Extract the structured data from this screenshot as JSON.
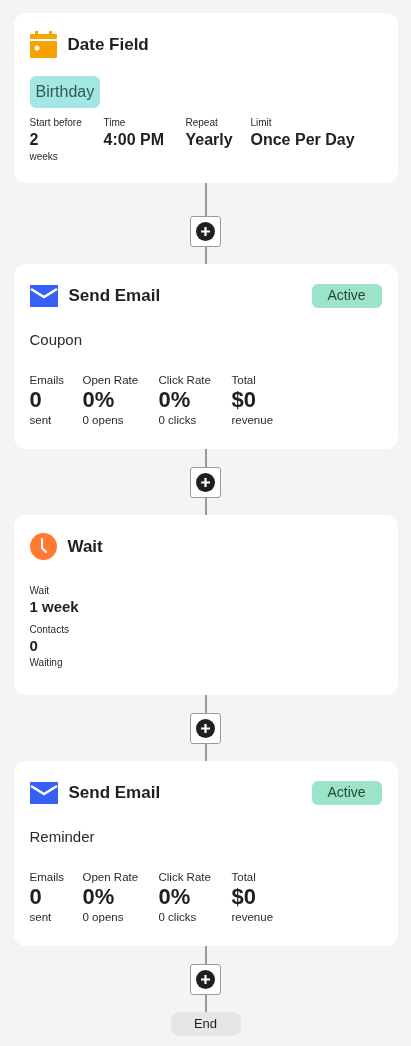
{
  "steps": [
    {
      "kind": "trigger",
      "title": "Date Field",
      "tag": "Birthday",
      "stats": [
        {
          "label": "Start before",
          "value": "2",
          "sub": "weeks"
        },
        {
          "label": "Time",
          "value": "4:00 PM"
        },
        {
          "label": "Repeat",
          "value": "Yearly"
        },
        {
          "label": "Limit",
          "value": "Once Per Day"
        }
      ]
    },
    {
      "kind": "email",
      "title": "Send Email",
      "status": "Active",
      "subject": "Coupon",
      "stats": [
        {
          "label": "Emails",
          "value": "0",
          "sub": "sent"
        },
        {
          "label": "Open Rate",
          "value": "0%",
          "sub": "0 opens"
        },
        {
          "label": "Click Rate",
          "value": "0%",
          "sub": "0 clicks"
        },
        {
          "label": "Total",
          "value": "$0",
          "sub": "revenue"
        }
      ]
    },
    {
      "kind": "wait",
      "title": "Wait",
      "stats": [
        {
          "label": "Wait",
          "value": "1 week"
        },
        {
          "label": "Contacts",
          "value": "0",
          "sub": "Waiting"
        }
      ]
    },
    {
      "kind": "email",
      "title": "Send Email",
      "status": "Active",
      "subject": "Reminder",
      "stats": [
        {
          "label": "Emails",
          "value": "0",
          "sub": "sent"
        },
        {
          "label": "Open Rate",
          "value": "0%",
          "sub": "0 opens"
        },
        {
          "label": "Click Rate",
          "value": "0%",
          "sub": "0 clicks"
        },
        {
          "label": "Total",
          "value": "$0",
          "sub": "revenue"
        }
      ]
    }
  ],
  "end": "End"
}
